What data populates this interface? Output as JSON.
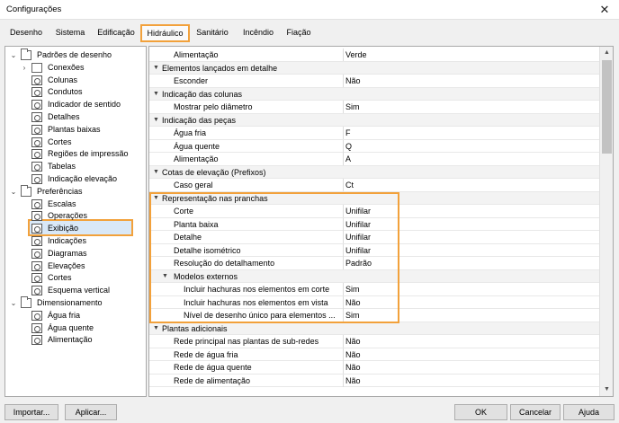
{
  "window": {
    "title": "Configurações"
  },
  "tabs": [
    "Desenho",
    "Sistema",
    "Edificação",
    "Hidráulico",
    "Sanitário",
    "Incêndio",
    "Fiação"
  ],
  "active_tab": "Hidráulico",
  "tree": [
    {
      "label": "Padrões de desenho",
      "level": 0,
      "expander": "v",
      "icon": "folder"
    },
    {
      "label": "Conexões",
      "level": 1,
      "expander": ">",
      "icon": "sheet"
    },
    {
      "label": "Colunas",
      "level": 1,
      "expander": "",
      "icon": "ruler"
    },
    {
      "label": "Condutos",
      "level": 1,
      "expander": "",
      "icon": "ruler"
    },
    {
      "label": "Indicador de sentido",
      "level": 1,
      "expander": "",
      "icon": "ruler"
    },
    {
      "label": "Detalhes",
      "level": 1,
      "expander": "",
      "icon": "ruler"
    },
    {
      "label": "Plantas baixas",
      "level": 1,
      "expander": "",
      "icon": "ruler"
    },
    {
      "label": "Cortes",
      "level": 1,
      "expander": "",
      "icon": "ruler"
    },
    {
      "label": "Regiões de impressão",
      "level": 1,
      "expander": "",
      "icon": "ruler"
    },
    {
      "label": "Tabelas",
      "level": 1,
      "expander": "",
      "icon": "ruler"
    },
    {
      "label": "Indicação elevação",
      "level": 1,
      "expander": "",
      "icon": "ruler"
    },
    {
      "label": "Preferências",
      "level": 0,
      "expander": "v",
      "icon": "folder"
    },
    {
      "label": "Escalas",
      "level": 1,
      "expander": "",
      "icon": "ruler"
    },
    {
      "label": "Operações",
      "level": 1,
      "expander": "",
      "icon": "ruler"
    },
    {
      "label": "Exibição",
      "level": 1,
      "expander": "",
      "icon": "ruler"
    },
    {
      "label": "Indicações",
      "level": 1,
      "expander": "",
      "icon": "ruler"
    },
    {
      "label": "Diagramas",
      "level": 1,
      "expander": "",
      "icon": "ruler"
    },
    {
      "label": "Elevações",
      "level": 1,
      "expander": "",
      "icon": "ruler"
    },
    {
      "label": "Cortes",
      "level": 1,
      "expander": "",
      "icon": "ruler"
    },
    {
      "label": "Esquema vertical",
      "level": 1,
      "expander": "",
      "icon": "ruler"
    },
    {
      "label": "Dimensionamento",
      "level": 0,
      "expander": "v",
      "icon": "folder"
    },
    {
      "label": "Água fria",
      "level": 1,
      "expander": "",
      "icon": "ruler"
    },
    {
      "label": "Água quente",
      "level": 1,
      "expander": "",
      "icon": "ruler"
    },
    {
      "label": "Alimentação",
      "level": 1,
      "expander": "",
      "icon": "ruler"
    }
  ],
  "grid": [
    {
      "name": "Alimentação",
      "value": "Verde",
      "type": "prop",
      "indent": 1
    },
    {
      "name": "Elementos lançados em detalhe",
      "value": "",
      "type": "cat",
      "indent": 0
    },
    {
      "name": "Esconder",
      "value": "Não",
      "type": "prop",
      "indent": 1
    },
    {
      "name": "Indicação das colunas",
      "value": "",
      "type": "cat",
      "indent": 0
    },
    {
      "name": "Mostrar pelo diâmetro",
      "value": "Sim",
      "type": "prop",
      "indent": 1
    },
    {
      "name": "Indicação das peças",
      "value": "",
      "type": "cat",
      "indent": 0
    },
    {
      "name": "Água fria",
      "value": "F",
      "type": "prop",
      "indent": 1
    },
    {
      "name": "Água quente",
      "value": "Q",
      "type": "prop",
      "indent": 1
    },
    {
      "name": "Alimentação",
      "value": "A",
      "type": "prop",
      "indent": 1
    },
    {
      "name": "Cotas de elevação (Prefixos)",
      "value": "",
      "type": "cat",
      "indent": 0
    },
    {
      "name": "Caso geral",
      "value": "Ct",
      "type": "prop",
      "indent": 1
    },
    {
      "name": "Representação nas pranchas",
      "value": "",
      "type": "cat",
      "indent": 0
    },
    {
      "name": "Corte",
      "value": "Unifilar",
      "type": "prop",
      "indent": 1
    },
    {
      "name": "Planta baixa",
      "value": "Unifilar",
      "type": "prop",
      "indent": 1
    },
    {
      "name": "Detalhe",
      "value": "Unifilar",
      "type": "prop",
      "indent": 1
    },
    {
      "name": "Detalhe isométrico",
      "value": "Unifilar",
      "type": "prop",
      "indent": 1
    },
    {
      "name": "Resolução do detalhamento",
      "value": "Padrão",
      "type": "prop",
      "indent": 1
    },
    {
      "name": "Modelos externos",
      "value": "",
      "type": "subcat",
      "indent": 1
    },
    {
      "name": "Incluir hachuras nos elementos em corte",
      "value": "Sim",
      "type": "prop",
      "indent": 2
    },
    {
      "name": "Incluir hachuras nos elementos em vista",
      "value": "Não",
      "type": "prop",
      "indent": 2
    },
    {
      "name": "Nível de desenho único para elementos ...",
      "value": "Sim",
      "type": "prop",
      "indent": 2
    },
    {
      "name": "Plantas adicionais",
      "value": "",
      "type": "cat",
      "indent": 0
    },
    {
      "name": "Rede principal nas plantas de sub-redes",
      "value": "Não",
      "type": "prop",
      "indent": 1
    },
    {
      "name": "Rede de água fria",
      "value": "Não",
      "type": "prop",
      "indent": 1
    },
    {
      "name": "Rede de água quente",
      "value": "Não",
      "type": "prop",
      "indent": 1
    },
    {
      "name": "Rede de alimentação",
      "value": "Não",
      "type": "prop",
      "indent": 1
    }
  ],
  "buttons": {
    "import": "Importar...",
    "apply": "Aplicar...",
    "ok": "OK",
    "cancel": "Cancelar",
    "help": "Ajuda"
  },
  "highlight_color": "#f2a13b"
}
